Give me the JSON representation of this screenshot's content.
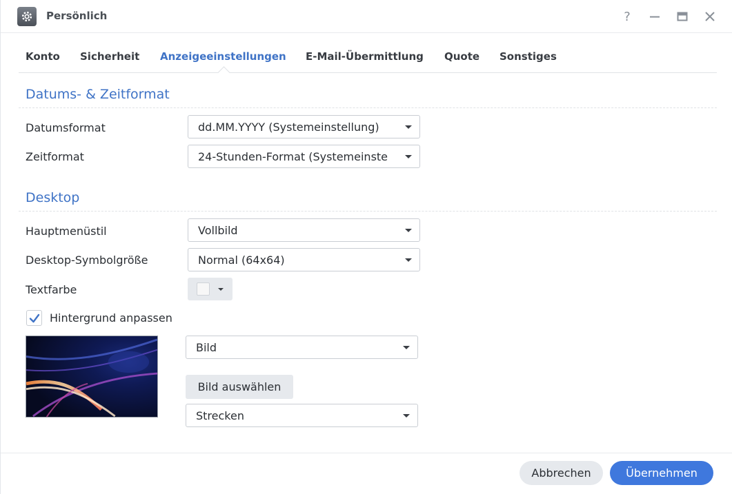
{
  "window": {
    "title": "Persönlich",
    "icon": "settings-gear-icon",
    "controls": {
      "help": "?",
      "help_icon": "help-icon",
      "minimize_icon": "minimize-icon",
      "maximize_icon": "maximize-icon",
      "close_icon": "close-icon"
    }
  },
  "tabs": [
    {
      "label": "Konto",
      "active": false
    },
    {
      "label": "Sicherheit",
      "active": false
    },
    {
      "label": "Anzeigeeinstellungen",
      "active": true
    },
    {
      "label": "E-Mail-Übermittlung",
      "active": false
    },
    {
      "label": "Quote",
      "active": false
    },
    {
      "label": "Sonstiges",
      "active": false
    }
  ],
  "date_time": {
    "title": "Datums- & Zeitformat",
    "date_format_label": "Datumsformat",
    "date_format_value": "dd.MM.YYYY (Systemeinstellung)",
    "time_format_label": "Zeitformat",
    "time_format_value": "24-Stunden-Format (Systemeinste"
  },
  "desktop": {
    "title": "Desktop",
    "main_menu_style_label": "Hauptmenüstil",
    "main_menu_style_value": "Vollbild",
    "icon_size_label": "Desktop-Symbolgröße",
    "icon_size_value": "Normal (64x64)",
    "text_color_label": "Textfarbe",
    "text_color_value": "#f7f7f7",
    "custom_background_label": "Hintergrund anpassen",
    "custom_background_checked": true,
    "background_type_value": "Bild",
    "choose_image_label": "Bild auswählen",
    "image_fit_value": "Strecken"
  },
  "footer": {
    "cancel_label": "Abbrechen",
    "apply_label": "Übernehmen"
  },
  "colors": {
    "accent": "#3f73c6",
    "primary_button": "#3f78dd",
    "secondary_button": "#e6e9ed"
  }
}
